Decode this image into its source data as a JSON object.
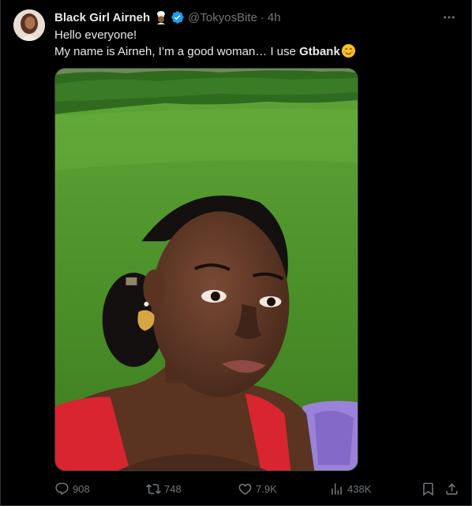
{
  "tweet": {
    "author_name": "Black Girl Airneh",
    "handle": "@TokyosBite",
    "separator": "·",
    "time": "4h",
    "text_line1": "Hello everyone!",
    "text_line2_prefix": "My name is Airneh, I’m a good woman… I use ",
    "text_line2_bold": "Gtbank",
    "icons": {
      "verified": "verified-badge-icon",
      "chef": "chef-emoji-icon",
      "smile": "smiling-face-emoji-icon"
    },
    "colors": {
      "background": "#000000",
      "text": "#e7e9ea",
      "muted": "#71767b",
      "verified": "#1d9bf0"
    }
  },
  "actions": {
    "replies": "908",
    "retweets": "748",
    "likes": "7.9K",
    "views": "438K"
  }
}
